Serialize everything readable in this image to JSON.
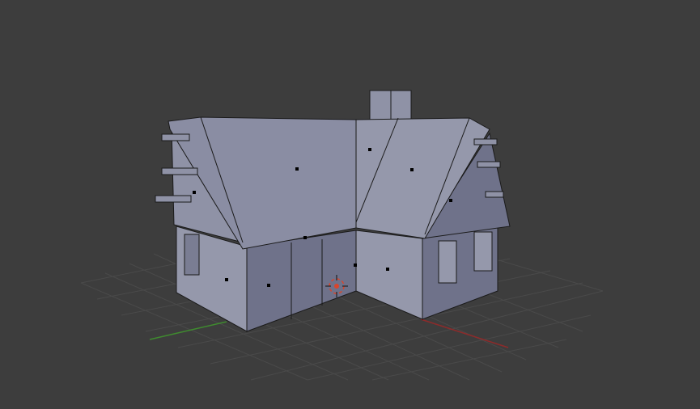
{
  "viewport": {
    "background_color": "#3d3d3d",
    "grid_color": "#4a4a4a",
    "axis_x_color": "#8c2b2b",
    "axis_y_color": "#3f8b2f",
    "cursor_color": "#d9452b",
    "model_face_color": "#8f92a6",
    "model_shadow_color": "#6f728a",
    "model_edge_color": "#1a1a1a",
    "vertex_color": "#000000"
  },
  "objects": {
    "mesh_name": "house-mesh",
    "cursor_icon": "3d-cursor-icon",
    "chimney_icon": "chimney-icon"
  }
}
